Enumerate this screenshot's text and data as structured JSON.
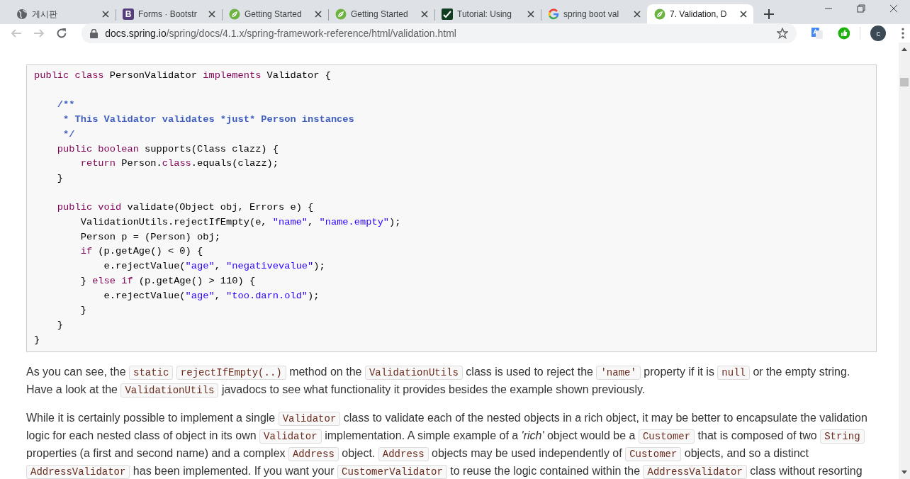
{
  "tabs": [
    {
      "kind": "globe",
      "title": "게시판",
      "selected": false
    },
    {
      "kind": "letter",
      "badge": "B",
      "title": "Forms · Bootstr",
      "selected": false
    },
    {
      "kind": "leaf",
      "title": "Getting Started",
      "selected": false
    },
    {
      "kind": "leaf",
      "title": "Getting Started",
      "selected": false
    },
    {
      "kind": "check",
      "title": "Tutorial: Using",
      "selected": false
    },
    {
      "kind": "google",
      "title": "spring boot val",
      "selected": false
    },
    {
      "kind": "leaf",
      "title": "7. Validation, D",
      "selected": true
    }
  ],
  "toolbar": {
    "url_domain": "docs.spring.io",
    "url_path": "/spring/docs/4.1.x/spring-framework-reference/html/validation.html",
    "profile": "c"
  },
  "content": {
    "code": [
      {
        "kind": "keyword",
        "text": "public class"
      },
      {
        "kind": "plain",
        "text": " PersonValidator "
      },
      {
        "kind": "keyword",
        "text": "implements"
      },
      {
        "kind": "plain",
        "text": " Validator {\n\n    "
      },
      {
        "kind": "comment",
        "text": "/**\n     * This Validator validates *just* Person instances\n     */\n    "
      },
      {
        "kind": "keyword",
        "text": "public boolean"
      },
      {
        "kind": "plain",
        "text": " supports(Class clazz) {\n        "
      },
      {
        "kind": "keyword",
        "text": "return"
      },
      {
        "kind": "plain",
        "text": " Person."
      },
      {
        "kind": "keyword",
        "text": "class"
      },
      {
        "kind": "plain",
        "text": ".equals(clazz);\n    }\n\n    "
      },
      {
        "kind": "keyword",
        "text": "public void"
      },
      {
        "kind": "plain",
        "text": " validate(Object obj, Errors e) {\n        ValidationUtils.rejectIfEmpty(e, "
      },
      {
        "kind": "string",
        "text": "\"name\""
      },
      {
        "kind": "plain",
        "text": ", "
      },
      {
        "kind": "string",
        "text": "\"name.empty\""
      },
      {
        "kind": "plain",
        "text": ");\n        Person p = (Person) obj;\n        "
      },
      {
        "kind": "keyword",
        "text": "if"
      },
      {
        "kind": "plain",
        "text": " (p.getAge() < 0) {\n            e.rejectValue("
      },
      {
        "kind": "string",
        "text": "\"age\""
      },
      {
        "kind": "plain",
        "text": ", "
      },
      {
        "kind": "string",
        "text": "\"negativevalue\""
      },
      {
        "kind": "plain",
        "text": ");\n        } "
      },
      {
        "kind": "keyword",
        "text": "else if"
      },
      {
        "kind": "plain",
        "text": " (p.getAge() > 110) {\n            e.rejectValue("
      },
      {
        "kind": "string",
        "text": "\"age\""
      },
      {
        "kind": "plain",
        "text": ", "
      },
      {
        "kind": "string",
        "text": "\"too.darn.old\""
      },
      {
        "kind": "plain",
        "text": ");\n        }\n    }\n}"
      }
    ],
    "paragraphs": [
      [
        {
          "kind": "text",
          "text": "As you can see, the "
        },
        {
          "kind": "code",
          "text": "static"
        },
        {
          "kind": "code",
          "text": "rejectIfEmpty(..)"
        },
        {
          "kind": "text",
          "text": " method on the "
        },
        {
          "kind": "code",
          "text": "ValidationUtils"
        },
        {
          "kind": "text",
          "text": " class is used to reject the "
        },
        {
          "kind": "code",
          "text": "'name'"
        },
        {
          "kind": "text",
          "text": " property if it is "
        },
        {
          "kind": "code",
          "text": "null"
        },
        {
          "kind": "text",
          "text": " or the empty string. Have a look at the "
        },
        {
          "kind": "code",
          "text": "ValidationUtils"
        },
        {
          "kind": "text",
          "text": " javadocs to see what functionality it provides besides the example shown previously."
        }
      ],
      [
        {
          "kind": "text",
          "text": "While it is certainly possible to implement a single "
        },
        {
          "kind": "code",
          "text": "Validator"
        },
        {
          "kind": "text",
          "text": " class to validate each of the nested objects in a rich object, it may be better to encapsulate the validation logic for each nested class of object in its own "
        },
        {
          "kind": "code",
          "text": "Validator"
        },
        {
          "kind": "text",
          "text": " implementation. A simple example of a *'rich'* object would be a "
        },
        {
          "kind": "code",
          "text": "Customer"
        },
        {
          "kind": "text",
          "text": " that is composed of two "
        },
        {
          "kind": "code",
          "text": "String"
        },
        {
          "kind": "text",
          "text": " properties (a first and second name) and a complex "
        },
        {
          "kind": "code",
          "text": "Address"
        },
        {
          "kind": "text",
          "text": " object. "
        },
        {
          "kind": "code",
          "text": "Address"
        },
        {
          "kind": "text",
          "text": " objects may be used independently of "
        },
        {
          "kind": "code",
          "text": "Customer"
        },
        {
          "kind": "text",
          "text": " objects, and so a distinct "
        },
        {
          "kind": "code",
          "text": "AddressValidator"
        },
        {
          "kind": "text",
          "text": " has been implemented. If you want your "
        },
        {
          "kind": "code",
          "text": "CustomerValidator"
        },
        {
          "kind": "text",
          "text": " to reuse the logic contained within the "
        },
        {
          "kind": "code",
          "text": "AddressValidator"
        },
        {
          "kind": "text",
          "text": " class without resorting"
        }
      ]
    ]
  }
}
